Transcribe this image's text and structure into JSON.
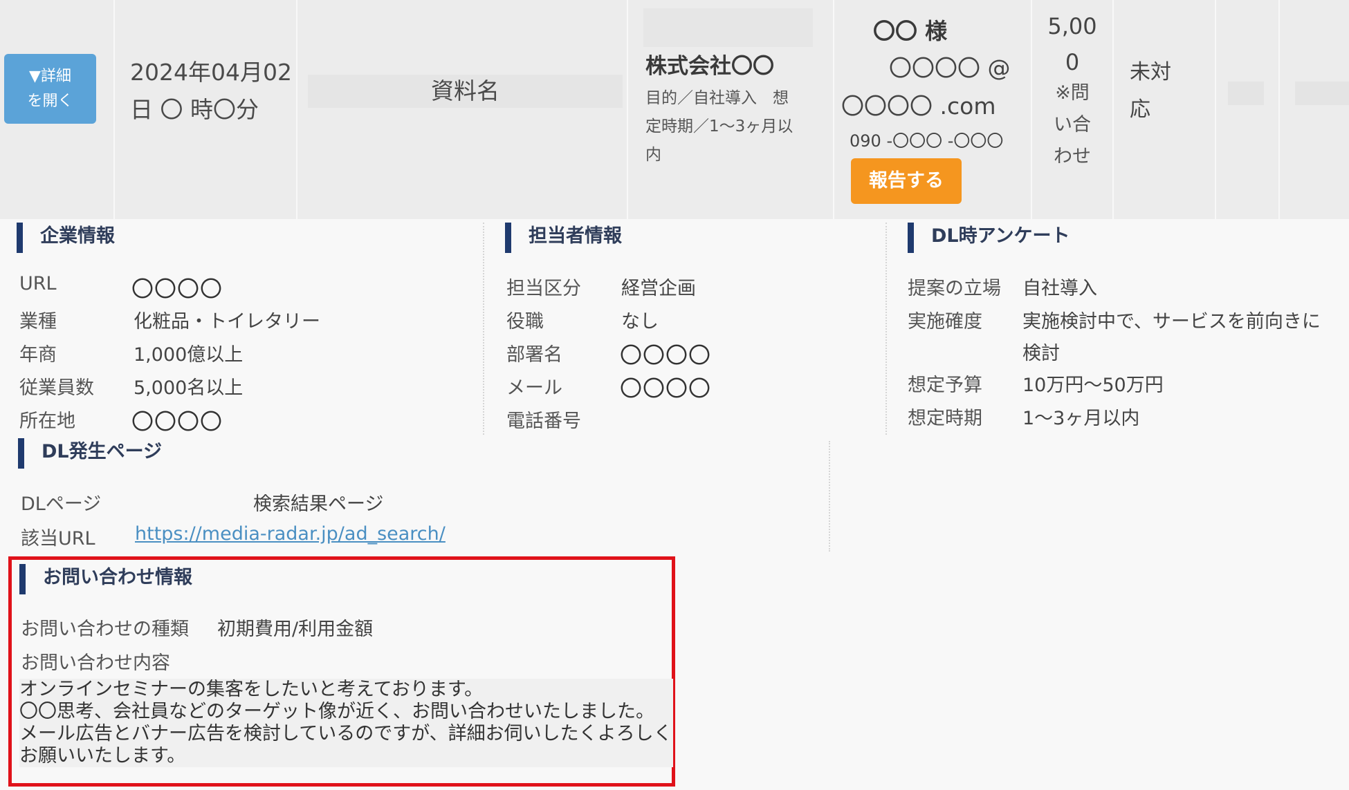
{
  "row": {
    "detail_button": "▼詳細\nを開く",
    "detail_line1": "▼詳細",
    "detail_line2": "を開く",
    "date_line1": "2024年04月02",
    "date_line2": "日 〇 時〇分",
    "document_name": "資料名",
    "company_name": "株式会社〇〇",
    "purpose_line1": "目的／自社導入　想",
    "purpose_line2": "定時期／1〜3ヶ月以",
    "purpose_line3": "内",
    "person_name": "〇〇 様",
    "email_line1": "〇〇〇〇 @",
    "email_line2": "〇〇〇〇 .com",
    "tel": "090 -〇〇〇 -〇〇〇",
    "report_button": "報告する",
    "amount_line1": "5,00",
    "amount_line2": "0",
    "amount_note1": "※問",
    "amount_note2": "い合",
    "amount_note3": "わせ",
    "status_line1": "未対",
    "status_line2": "応"
  },
  "company_info": {
    "title": "企業情報",
    "rows": [
      {
        "label": "URL",
        "value": "〇〇〇〇"
      },
      {
        "label": "業種",
        "value": "化粧品・トイレタリー"
      },
      {
        "label": "年商",
        "value": "1,000億以上"
      },
      {
        "label": "従業員数",
        "value": "5,000名以上"
      },
      {
        "label": "所在地",
        "value": "〇〇〇〇"
      }
    ]
  },
  "contact_info": {
    "title": "担当者情報",
    "rows": [
      {
        "label": "担当区分",
        "value": "経営企画"
      },
      {
        "label": "役職",
        "value": "なし"
      },
      {
        "label": "部署名",
        "value": "〇〇〇〇"
      },
      {
        "label": "メール",
        "value": "〇〇〇〇"
      },
      {
        "label": "電話番号",
        "value": ""
      }
    ]
  },
  "survey": {
    "title": "DL時アンケート",
    "rows": [
      {
        "label": "提案の立場",
        "value": "自社導入"
      },
      {
        "label": "実施確度",
        "value": "実施検討中で、サービスを前向きに",
        "value2": "検討"
      },
      {
        "label": "想定予算",
        "value": "10万円〜50万円"
      },
      {
        "label": "想定時期",
        "value": "1〜3ヶ月以内"
      }
    ]
  },
  "dl_page": {
    "title": "DL発生ページ",
    "page_label": "DLページ",
    "page_value": "検索結果ページ",
    "url_label": "該当URL",
    "url_value": "https://media-radar.jp/ad_search/"
  },
  "inquiry": {
    "title": "お問い合わせ情報",
    "type_label": "お問い合わせの種類",
    "type_value": "初期費用/利用金額",
    "content_label": "お問い合わせ内容",
    "content_body": "オンラインセミナーの集客をしたいと考えております。\n〇〇思考、会社員などのターゲット像が近く、お問い合わせいたしました。\nメール広告とバナー広告を検討しているのですが、詳細お伺いしたくよろしくお願いいたします。"
  },
  "colors": {
    "accent_blue": "#5ba3d8",
    "report_orange": "#f5961f",
    "section_bar": "#1f3a6e",
    "highlight_red": "#e0121a",
    "link": "#4a8fc2"
  }
}
